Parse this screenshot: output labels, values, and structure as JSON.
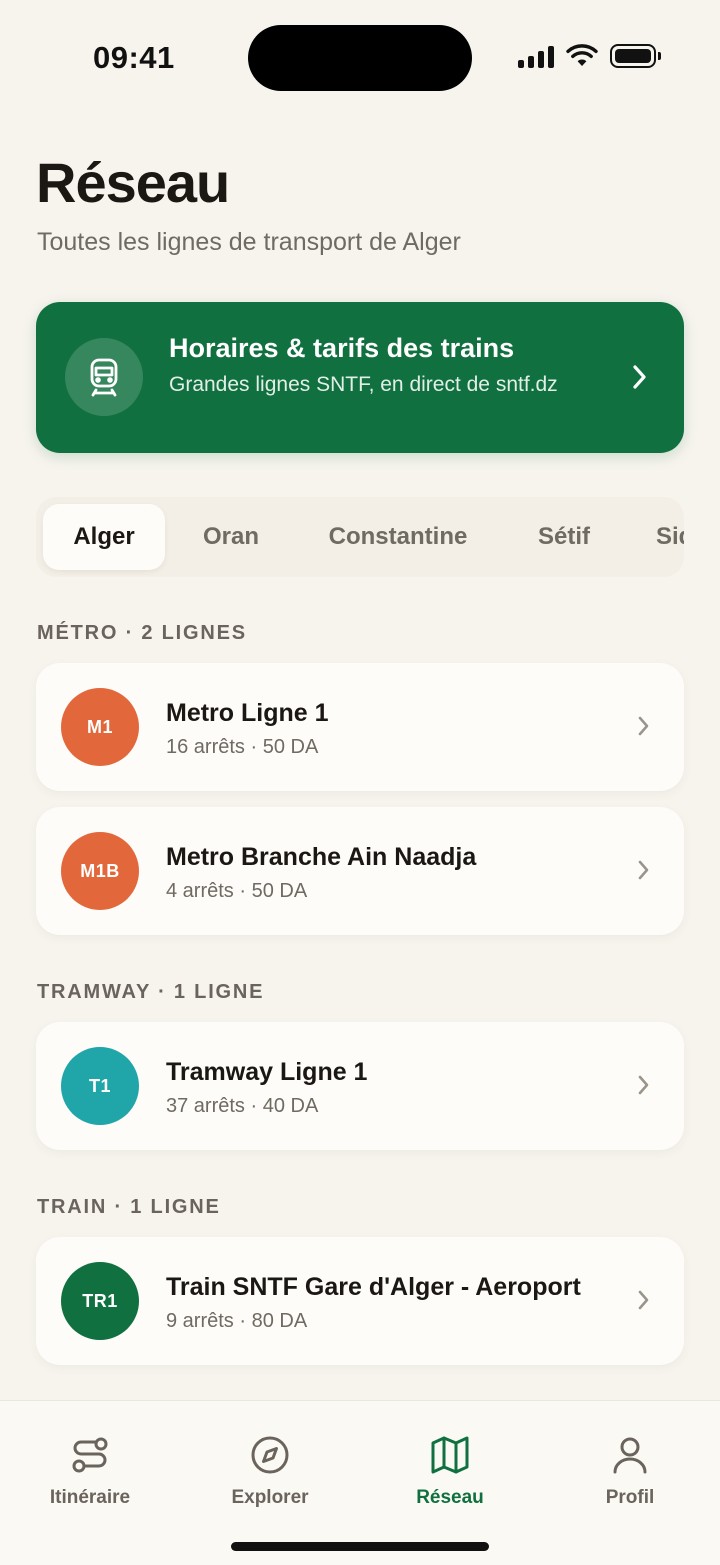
{
  "status_bar": {
    "time": "09:41"
  },
  "header": {
    "title": "Réseau",
    "subtitle": "Toutes les lignes de transport de Alger"
  },
  "banner": {
    "icon": "train-icon",
    "title": "Horaires & tarifs des trains",
    "subtitle": "Grandes lignes SNTF, en direct de sntf.dz",
    "color": "#10703f"
  },
  "city_tabs": [
    {
      "label": "Alger",
      "active": true
    },
    {
      "label": "Oran",
      "active": false
    },
    {
      "label": "Constantine",
      "active": false
    },
    {
      "label": "Sétif",
      "active": false
    },
    {
      "label": "Sidi Bel Abbès",
      "active": false
    }
  ],
  "sections": [
    {
      "header": "MÉTRO · 2 LIGNES",
      "lines": [
        {
          "code": "M1",
          "name": "Metro Ligne 1",
          "meta": "16 arrêts · 50 DA",
          "color": "#e2683c"
        },
        {
          "code": "M1B",
          "name": "Metro Branche Ain Naadja",
          "meta": "4 arrêts · 50 DA",
          "color": "#e2683c"
        }
      ]
    },
    {
      "header": "TRAMWAY · 1 LIGNE",
      "lines": [
        {
          "code": "T1",
          "name": "Tramway Ligne 1",
          "meta": "37 arrêts · 40 DA",
          "color": "#20a5a8"
        }
      ]
    },
    {
      "header": "TRAIN · 1 LIGNE",
      "lines": [
        {
          "code": "TR1",
          "name": "Train SNTF Gare d'Alger - Aeroport",
          "meta": "9 arrêts · 80 DA",
          "color": "#10703f"
        }
      ]
    }
  ],
  "tab_bar": {
    "items": [
      {
        "label": "Itinéraire",
        "icon": "route-icon",
        "active": false
      },
      {
        "label": "Explorer",
        "icon": "compass-icon",
        "active": false
      },
      {
        "label": "Réseau",
        "icon": "map-icon",
        "active": true
      },
      {
        "label": "Profil",
        "icon": "user-icon",
        "active": false
      }
    ],
    "active_color": "#10703f"
  }
}
